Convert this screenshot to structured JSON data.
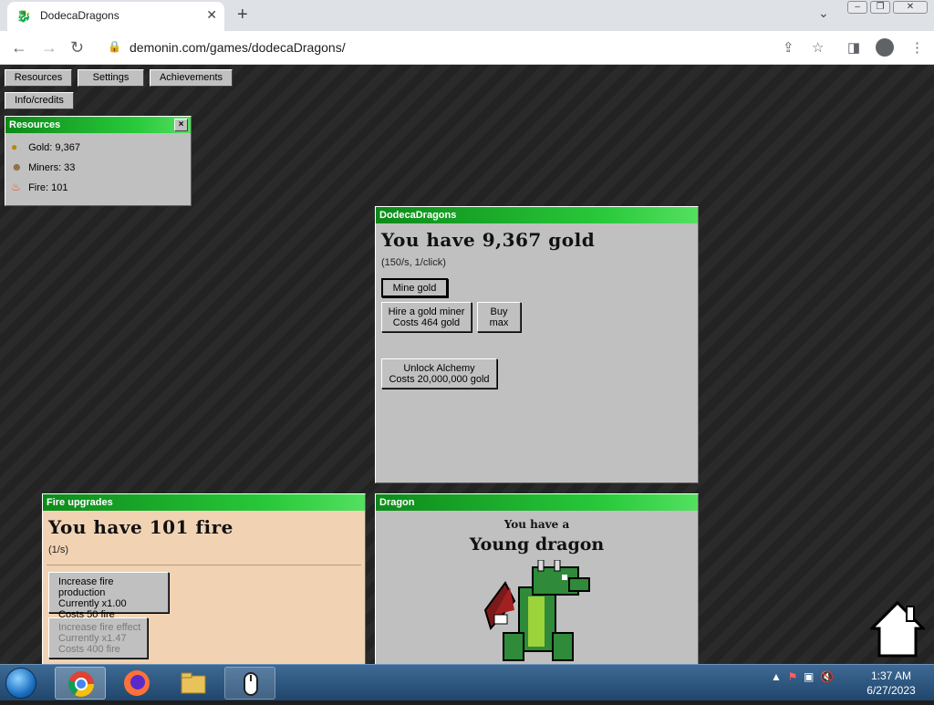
{
  "browser": {
    "tab_title": "DodecaDragons",
    "tab_icon": "dragon-favicon",
    "new_tab": "+",
    "url": "demonin.com/games/dodecaDragons/"
  },
  "nav": {
    "resources": "Resources",
    "settings": "Settings",
    "achievements": "Achievements",
    "info": "Info/credits"
  },
  "resources_panel": {
    "title": "Resources",
    "close": "×",
    "gold": "Gold: 9,367",
    "miners": "Miners: 33",
    "fire": "Fire: 101"
  },
  "main_panel": {
    "title": "DodecaDragons",
    "heading": "You have 9,367 gold",
    "rate": "(150/s, 1/click)",
    "mine_button": "Mine gold",
    "hire_line1": "Hire a gold miner",
    "hire_line2": "Costs 464 gold",
    "buy_max_line1": "Buy",
    "buy_max_line2": "max",
    "alchemy_line1": "Unlock Alchemy",
    "alchemy_line2": "Costs 20,000,000 gold"
  },
  "fire_panel": {
    "title": "Fire upgrades",
    "heading": "You have 101 fire",
    "rate": "(1/s)",
    "up1_line1": "Increase fire production",
    "up1_line2": "Currently x1.00",
    "up1_line3": "Costs 50 fire",
    "up2_line1": "Increase fire effect",
    "up2_line2": "Currently x1.47",
    "up2_line3": "Costs 400 fire"
  },
  "dragon_panel": {
    "title": "Dragon",
    "line1": "You have a",
    "line2": "Young dragon"
  },
  "taskbar": {
    "time": "1:37 AM",
    "date": "6/27/2023"
  },
  "colors": {
    "panel_header": "#28c93a",
    "panel_bg": "#c0c0c0",
    "fire_panel_bg": "#f1d3b4"
  }
}
